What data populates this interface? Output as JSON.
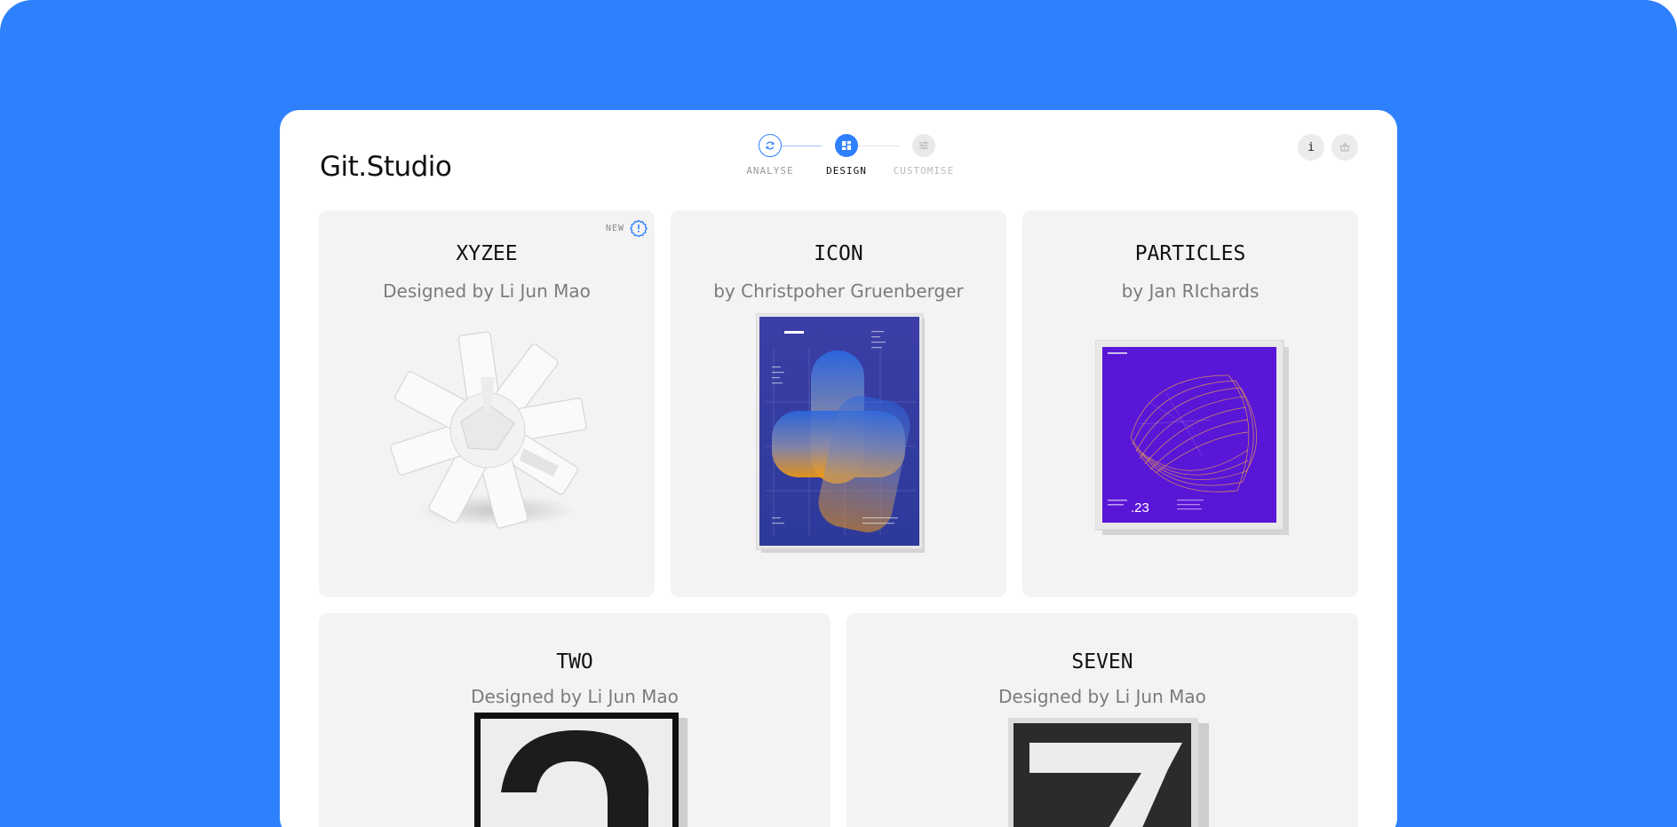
{
  "app": {
    "title": "Git.Studio"
  },
  "stepper": [
    {
      "label": "ANALYSE",
      "state": "completed"
    },
    {
      "label": "DESIGN",
      "state": "active"
    },
    {
      "label": "CUSTOMISE",
      "state": "upcoming"
    }
  ],
  "actions": {
    "info_label": "i",
    "cart_icon": "basket-icon"
  },
  "colors": {
    "background": "#2f80fd",
    "accent": "#2f80fd",
    "card": "#f3f3f3"
  },
  "designs": [
    {
      "title": "XYZEE",
      "subtitle": "Designed by Li Jun Mao",
      "badge": "NEW"
    },
    {
      "title": "ICON",
      "subtitle": "by Christpoher Gruenberger"
    },
    {
      "title": "PARTICLES",
      "subtitle": "by Jan RIchards",
      "poster_number": ".23"
    },
    {
      "title": "TWO",
      "subtitle": "Designed by Li Jun Mao"
    },
    {
      "title": "SEVEN",
      "subtitle": "Designed by Li Jun Mao"
    }
  ]
}
